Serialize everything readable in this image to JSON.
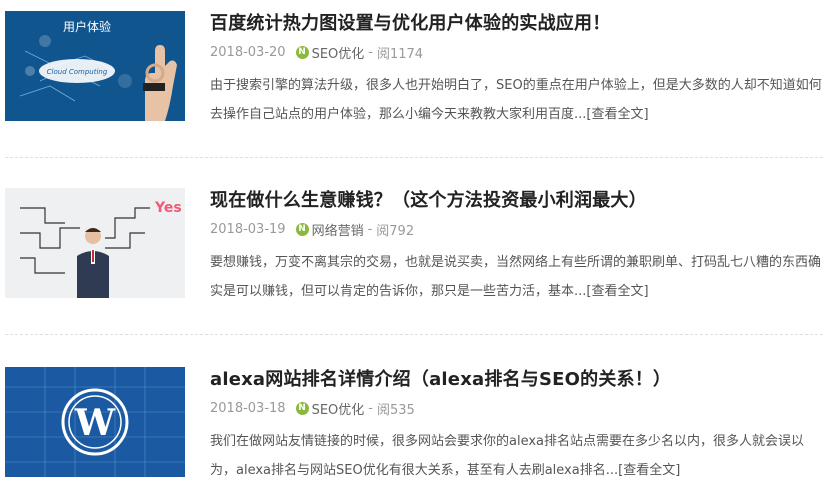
{
  "articles": [
    {
      "title": "百度统计热力图设置与优化用户体验的实战应用！",
      "date": "2018-03-20",
      "category": "SEO优化",
      "category_icon": "leaf-icon",
      "views": "阅1174",
      "excerpt": "由于搜索引擎的算法升级，很多人也开始明白了，SEO的重点在用户体验上，但是大多数的人却不知道如何去操作自己站点的用户体验，那么小编今天来教教大家利用百度...",
      "more_label": "[查看全文]",
      "thumb_text": "用户体验",
      "thumb_cloud_text": "Cloud Computing"
    },
    {
      "title": "现在做什么生意赚钱？（这个方法投资最小利润最大）",
      "date": "2018-03-19",
      "category": "网络营销",
      "category_icon": "leaf-icon",
      "views": "阅792",
      "excerpt": "要想赚钱，万变不离其宗的交易，也就是说买卖，当然网络上有些所谓的兼职刷单、打码乱七八糟的东西确实是可以赚钱，但可以肯定的告诉你，那只是一些苦力活，基本...",
      "more_label": "[查看全文]",
      "thumb_text": "Yes"
    },
    {
      "title": "alexa网站排名详情介绍（alexa排名与SEO的关系！）",
      "date": "2018-03-18",
      "category": "SEO优化",
      "category_icon": "leaf-icon",
      "views": "阅535",
      "excerpt": "我们在做网站友情链接的时候，很多网站会要求你的alexa排名站点需要在多少名以内，很多人就会误以为，alexa排名与网站SEO优化有很大关系，甚至有人去刷alexa排名...",
      "more_label": "[查看全文]",
      "thumb_text": ""
    }
  ],
  "colors": {
    "category_icon_bg": "#8db83f",
    "thumb1_bg": "#0f4f86",
    "thumb3_bg": "#1b5aa3"
  }
}
